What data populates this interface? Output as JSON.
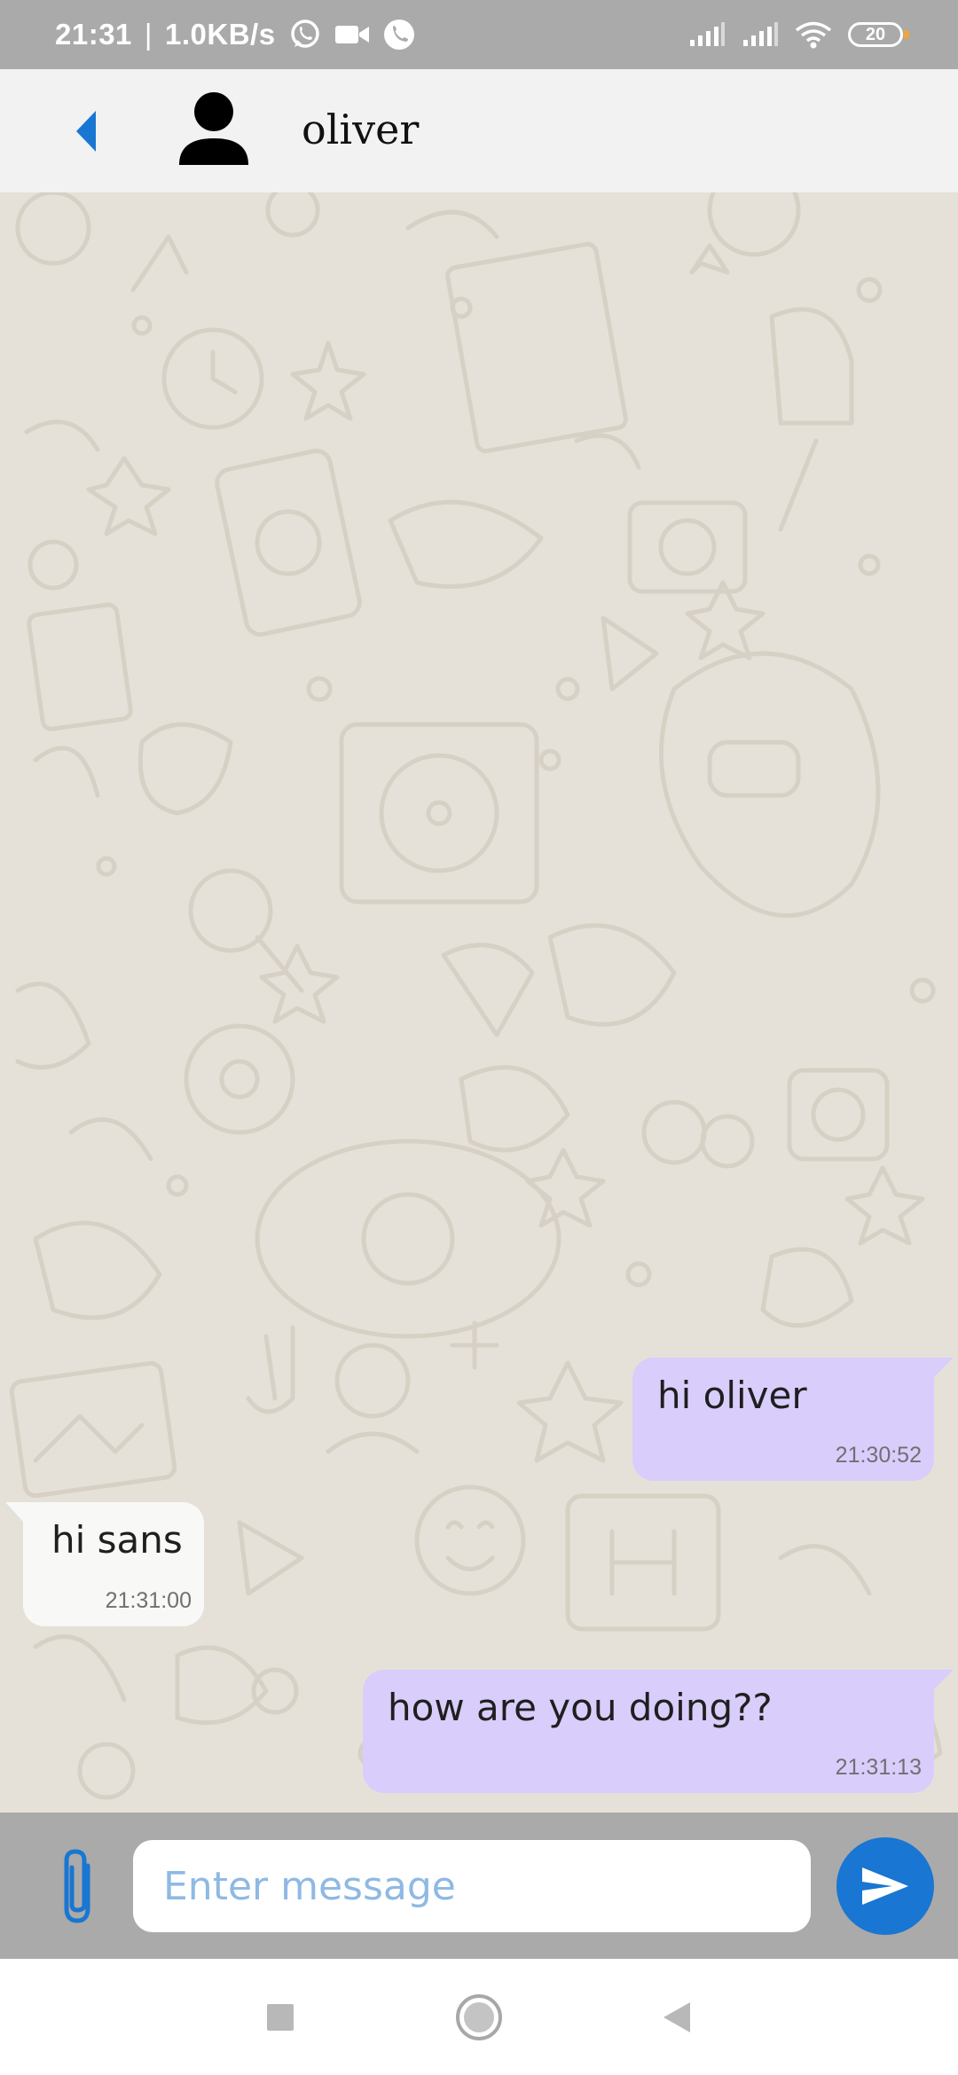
{
  "status_bar": {
    "time": "21:31",
    "separator": "|",
    "network_speed": "1.0KB/s",
    "left_icons": [
      "whatsapp-icon",
      "video-camera-icon",
      "phone-call-icon"
    ],
    "right_icons": [
      "signal-icon",
      "signal-icon",
      "wifi-icon",
      "battery-icon"
    ],
    "battery_level": "20"
  },
  "header": {
    "back_icon": "chevron-left-icon",
    "avatar_icon": "person-icon",
    "contact_name": "oliver",
    "accent_color": "#1976d2"
  },
  "chat": {
    "wallpaper": "doodle-pattern",
    "outgoing_bubble_color": "#d9cdfc",
    "incoming_bubble_color": "#f8f8f6",
    "messages": [
      {
        "direction": "outgoing",
        "text": "hi oliver",
        "time": "21:30:52"
      },
      {
        "direction": "incoming",
        "text": "hi sans",
        "time": "21:31:00"
      },
      {
        "direction": "outgoing",
        "text": "how are you doing??",
        "time": "21:31:13"
      }
    ]
  },
  "composer": {
    "attach_icon": "paperclip-icon",
    "placeholder": "Enter message",
    "value": "",
    "send_icon": "send-icon"
  },
  "nav_bar": {
    "buttons": [
      "recents-square-icon",
      "home-circle-icon",
      "back-triangle-icon"
    ]
  }
}
